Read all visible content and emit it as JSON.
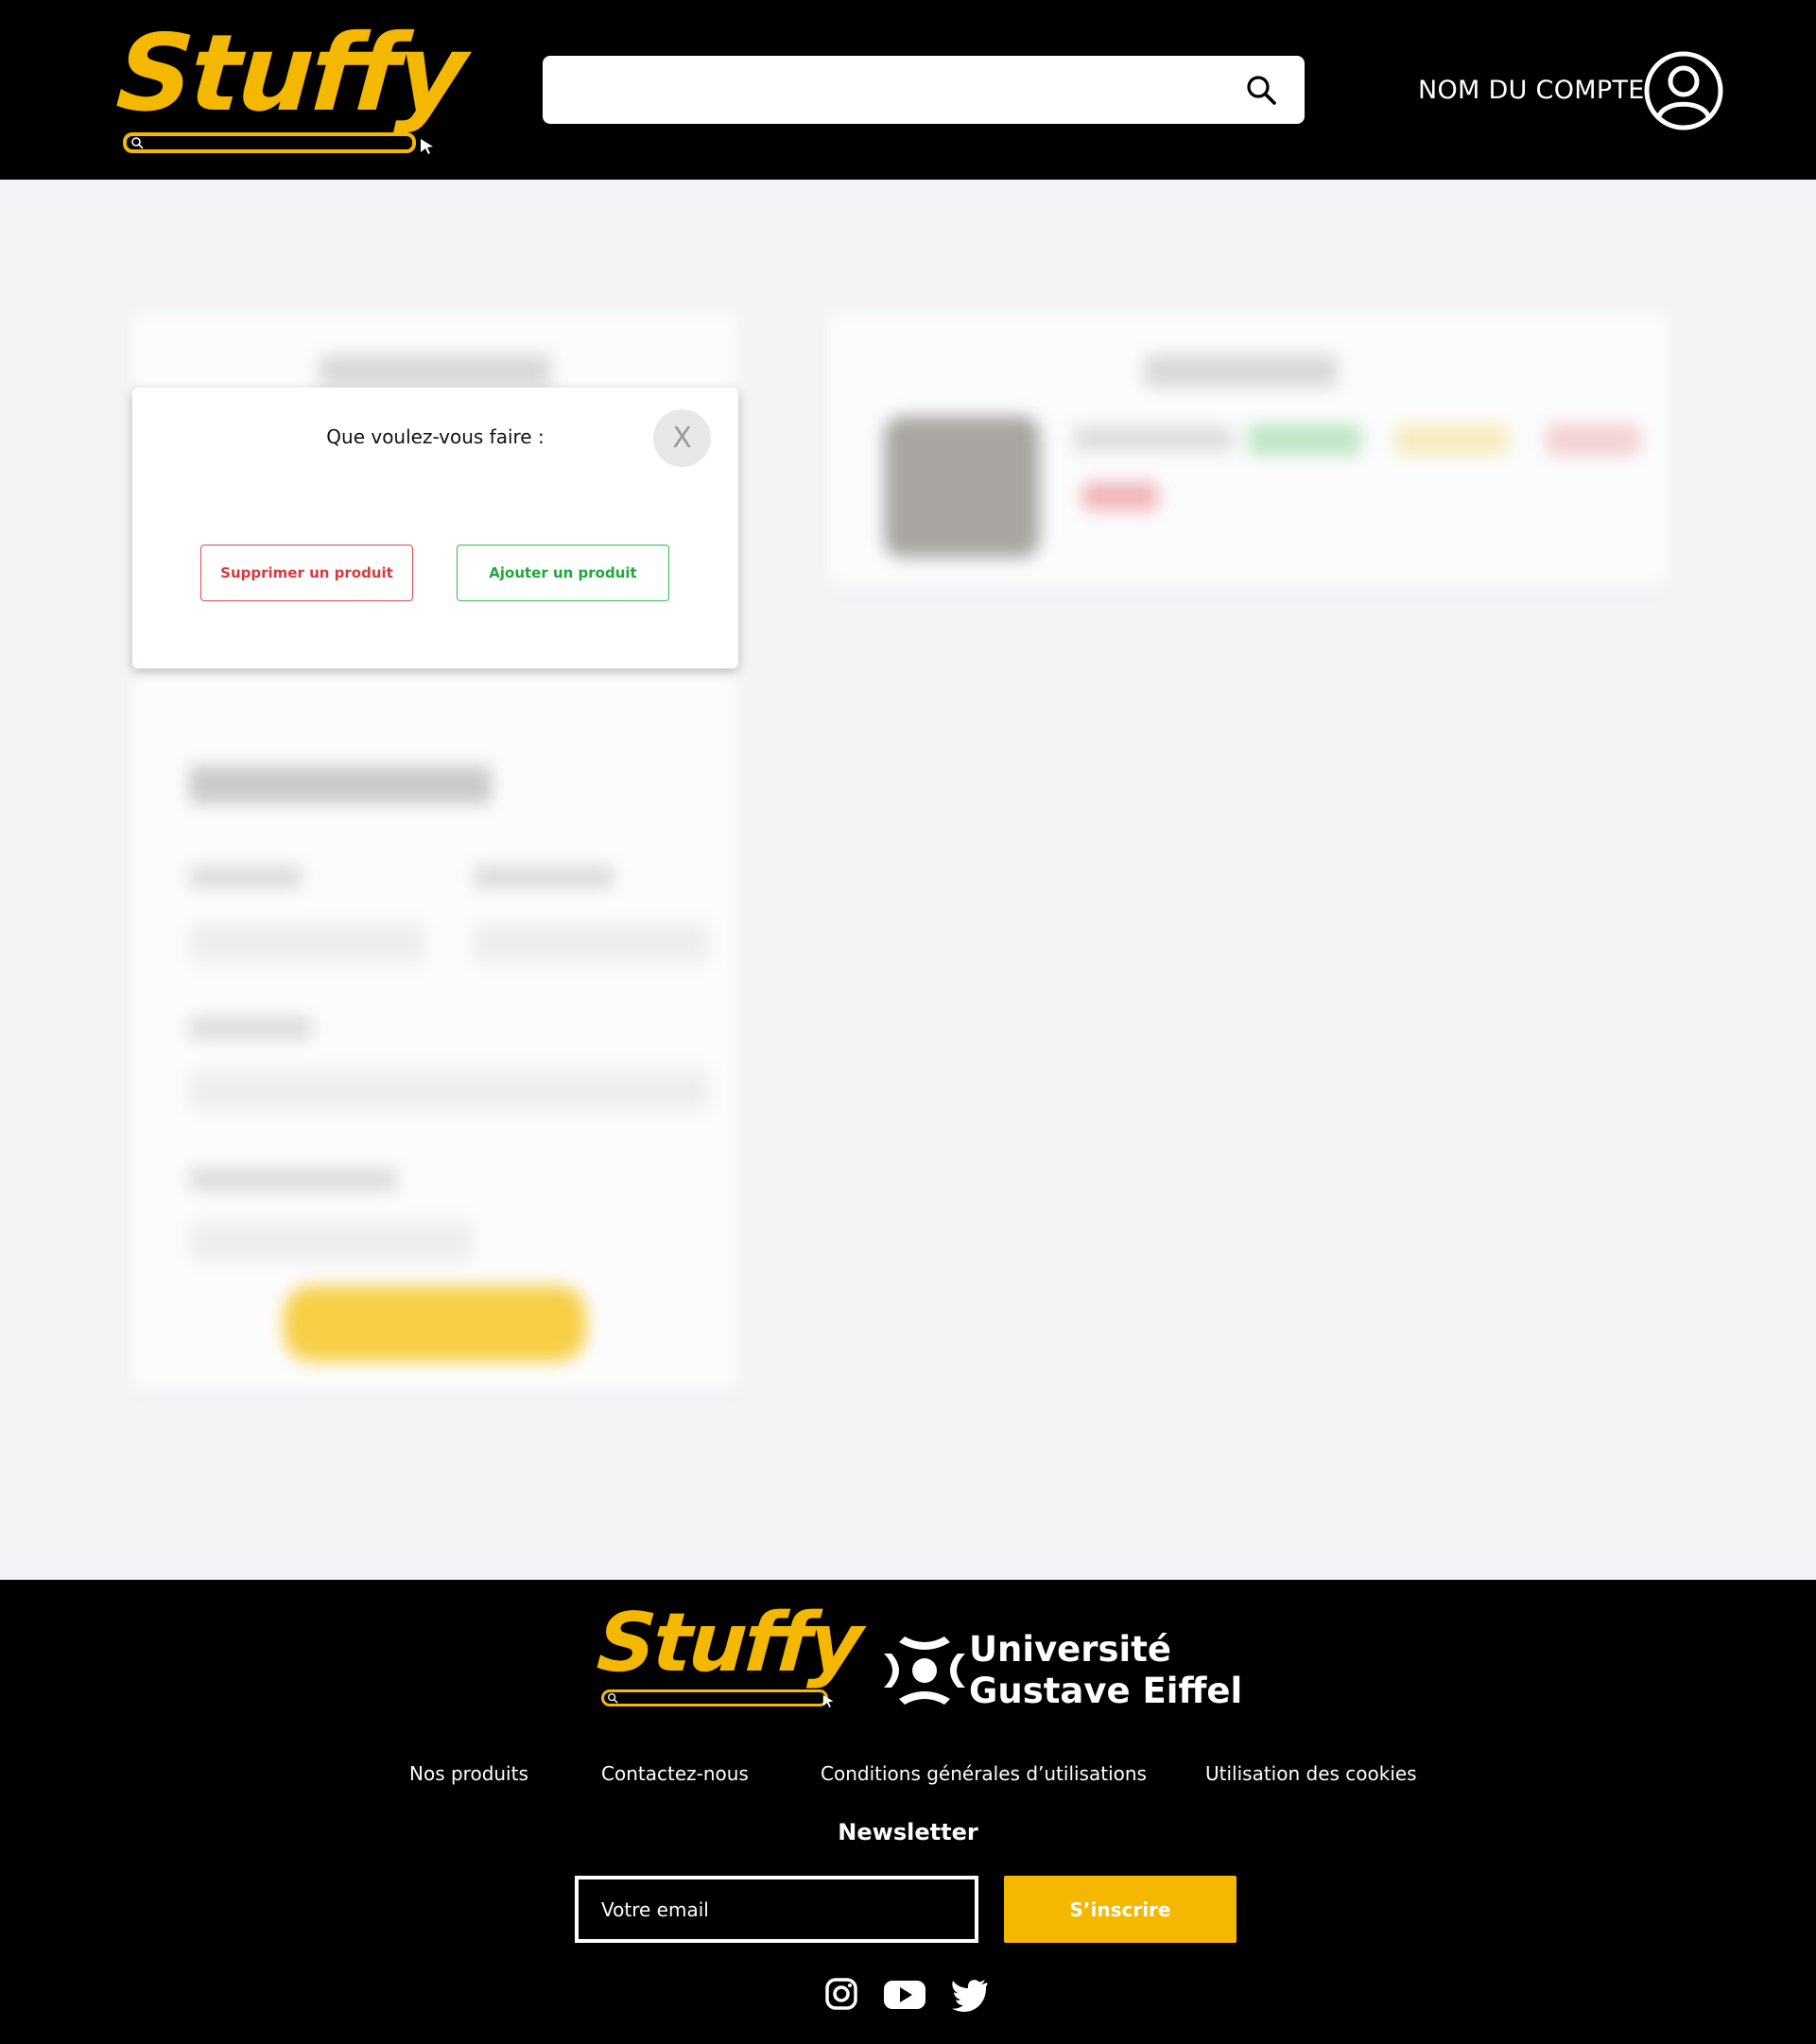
{
  "header": {
    "logo_text": "Stuffy",
    "search": {
      "value": "",
      "placeholder": ""
    },
    "account_name": "NOM DU COMPTE"
  },
  "modal": {
    "title": "Que voulez-vous faire :",
    "close_label": "X",
    "delete_label": "Supprimer un produit",
    "add_label": "Ajouter un produit"
  },
  "footer": {
    "logo_text": "Stuffy",
    "university_line1": "Université",
    "university_line2": "Gustave Eiffel",
    "links": [
      "Nos produits",
      "Contactez-nous",
      "Conditions générales d’utilisations",
      "Utilisation des cookies"
    ],
    "newsletter_title": "Newsletter",
    "email_placeholder": "Votre email",
    "subscribe_label": "S’inscrire",
    "social_icons": [
      "instagram-icon",
      "youtube-icon",
      "twitter-icon"
    ]
  },
  "colors": {
    "brand_yellow": "#f5b800",
    "header_bg": "#000000",
    "page_bg": "#f3f4f6",
    "delete_red": "#d93a3f",
    "add_green": "#20a83a"
  }
}
